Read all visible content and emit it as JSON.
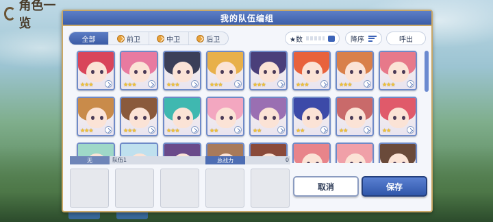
{
  "background": {
    "title": "角色一览"
  },
  "dialog": {
    "title": "我的队伍编组"
  },
  "filter": {
    "tabs": [
      {
        "label": "全部",
        "active": true
      },
      {
        "label": "前卫",
        "active": false
      },
      {
        "label": "中卫",
        "active": false
      },
      {
        "label": "后卫",
        "active": false
      }
    ],
    "sort_key_label": "★数",
    "sort_order_label": "降序",
    "call_label": "呼出"
  },
  "characters": [
    {
      "hair": "#d9455a",
      "stars": "★★★"
    },
    {
      "hair": "#e87aa0",
      "stars": "★★★"
    },
    {
      "hair": "#3b3f58",
      "stars": "★★★"
    },
    {
      "hair": "#e8b04a",
      "stars": "★★★"
    },
    {
      "hair": "#4a3f7a",
      "stars": "★★★"
    },
    {
      "hair": "#e8623c",
      "stars": "★★★"
    },
    {
      "hair": "#d9804a",
      "stars": "★★★"
    },
    {
      "hair": "#e7798a",
      "stars": "★★★"
    },
    {
      "hair": "#c98b4a",
      "stars": "★★★"
    },
    {
      "hair": "#8a5a3c",
      "stars": "★★★"
    },
    {
      "hair": "#3fb8b0",
      "stars": "★★★"
    },
    {
      "hair": "#f3a7c0",
      "stars": "★★"
    },
    {
      "hair": "#9a6fb2",
      "stars": "★★"
    },
    {
      "hair": "#3c4aa8",
      "stars": "★★"
    },
    {
      "hair": "#c96a6a",
      "stars": "★★"
    },
    {
      "hair": "#e05a6a",
      "stars": "★★"
    },
    {
      "hair": "#9fd8c8",
      "stars": ""
    },
    {
      "hair": "#bfe0ee",
      "stars": ""
    },
    {
      "hair": "#6a4a8a",
      "stars": ""
    },
    {
      "hair": "#a87a5a",
      "stars": ""
    },
    {
      "hair": "#8a4a3a",
      "stars": ""
    },
    {
      "hair": "#e8848a",
      "stars": ""
    },
    {
      "hair": "#f0a0a8",
      "stars": ""
    },
    {
      "hair": "#6a4a3a",
      "stars": ""
    }
  ],
  "party": {
    "tag": "无",
    "name": "队伍1",
    "power_label": "总战力",
    "power_value": "0",
    "slot_count": 5
  },
  "actions": {
    "cancel_label": "取消",
    "save_label": "保存"
  },
  "colors": {
    "header_blue": "#3c5ea8",
    "frame_gold": "#c9a867",
    "save_blue": "#3057aa"
  }
}
